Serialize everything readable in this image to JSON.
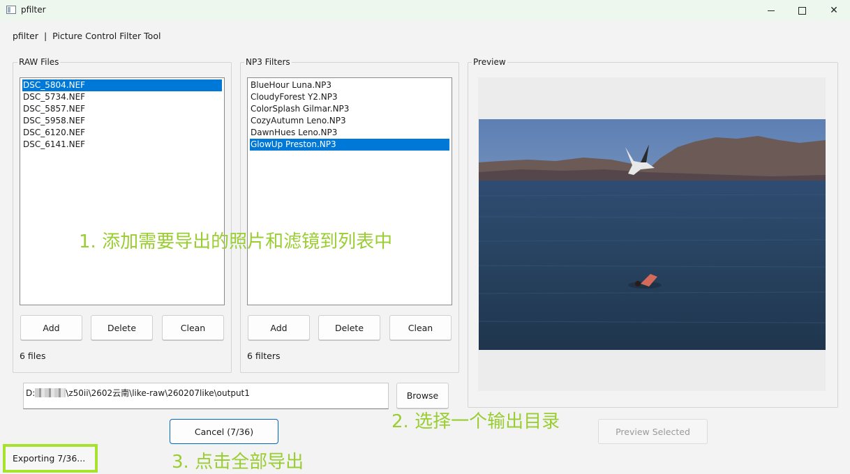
{
  "window": {
    "title": "pfilter"
  },
  "header": {
    "text": "pfilter  |  Picture Control Filter Tool"
  },
  "raw_files": {
    "label": "RAW Files",
    "items": [
      {
        "name": "DSC_5804.NEF",
        "selected": true
      },
      {
        "name": "DSC_5734.NEF",
        "selected": false
      },
      {
        "name": "DSC_5857.NEF",
        "selected": false
      },
      {
        "name": "DSC_5958.NEF",
        "selected": false
      },
      {
        "name": "DSC_6120.NEF",
        "selected": false
      },
      {
        "name": "DSC_6141.NEF",
        "selected": false
      }
    ],
    "add_label": "Add",
    "delete_label": "Delete",
    "clean_label": "Clean",
    "count": "6 files"
  },
  "np3_filters": {
    "label": "NP3 Filters",
    "items": [
      {
        "name": "BlueHour Luna.NP3",
        "selected": false
      },
      {
        "name": "CloudyForest Y2.NP3",
        "selected": false
      },
      {
        "name": "ColorSplash Gilmar.NP3",
        "selected": false
      },
      {
        "name": "CozyAutumn Leno.NP3",
        "selected": false
      },
      {
        "name": "DawnHues Leno.NP3",
        "selected": false
      },
      {
        "name": "GlowUp Preston.NP3",
        "selected": true
      }
    ],
    "add_label": "Add",
    "delete_label": "Delete",
    "clean_label": "Clean",
    "count": "6 filters"
  },
  "preview": {
    "label": "Preview",
    "selected_button": "Preview Selected"
  },
  "output": {
    "path_prefix": "D:",
    "path_suffix": "\\z50ii\\2602云南\\like-raw\\260207like\\output1",
    "browse_label": "Browse"
  },
  "actions": {
    "cancel_label": "Cancel (7/36)"
  },
  "status": {
    "text": "Exporting 7/36..."
  },
  "annotations": {
    "step1": "1. 添加需要导出的照片和滤镜到列表中",
    "step2": "2. 选择一个输出目录",
    "step3": "3. 点击全部导出"
  },
  "colors": {
    "selection": "#0078d7",
    "annotation": "#9acd32",
    "highlight_border": "#a6e22e",
    "primary_border": "#0067c0"
  }
}
